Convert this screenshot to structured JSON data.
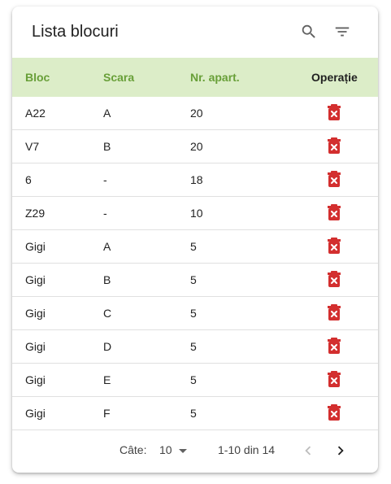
{
  "header": {
    "title": "Lista blocuri"
  },
  "table": {
    "columns": [
      "Bloc",
      "Scara",
      "Nr. apart.",
      "Operație"
    ],
    "rows": [
      {
        "bloc": "A22",
        "scara": "A",
        "nr": "20"
      },
      {
        "bloc": "V7",
        "scara": "B",
        "nr": "20"
      },
      {
        "bloc": "6",
        "scara": "-",
        "nr": "18"
      },
      {
        "bloc": "Z29",
        "scara": "-",
        "nr": "10"
      },
      {
        "bloc": "Gigi",
        "scara": "A",
        "nr": "5"
      },
      {
        "bloc": "Gigi",
        "scara": "B",
        "nr": "5"
      },
      {
        "bloc": "Gigi",
        "scara": "C",
        "nr": "5"
      },
      {
        "bloc": "Gigi",
        "scara": "D",
        "nr": "5"
      },
      {
        "bloc": "Gigi",
        "scara": "E",
        "nr": "5"
      },
      {
        "bloc": "Gigi",
        "scara": "F",
        "nr": "5"
      }
    ]
  },
  "pagination": {
    "rows_per_page_label": "Câte:",
    "rows_per_page_value": "10",
    "range": "1-10 din 14"
  },
  "colors": {
    "header_bg": "#dcedc8",
    "header_text": "#689f38",
    "delete_icon": "#d32f2f"
  }
}
